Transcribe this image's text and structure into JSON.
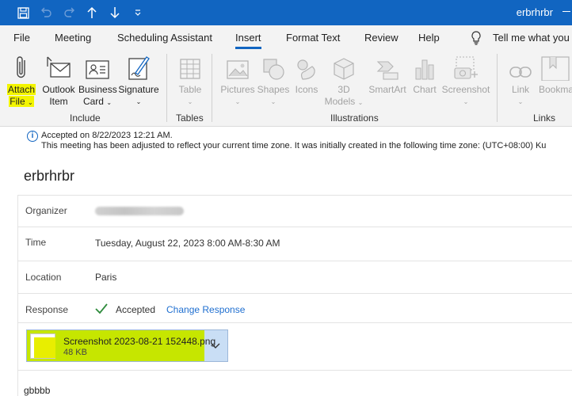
{
  "window": {
    "title": "erbrhrbr"
  },
  "quick_access": {
    "icons": [
      "save-icon",
      "undo-icon",
      "redo-icon",
      "arrow-up-icon",
      "arrow-down-icon",
      "customize-icon"
    ]
  },
  "tabs": [
    {
      "label": "File"
    },
    {
      "label": "Meeting"
    },
    {
      "label": "Scheduling Assistant"
    },
    {
      "label": "Insert",
      "active": true
    },
    {
      "label": "Format Text"
    },
    {
      "label": "Review"
    },
    {
      "label": "Help"
    },
    {
      "label": "Tell me what you"
    }
  ],
  "ribbon": {
    "include": {
      "label": "Include",
      "attach_file": {
        "line1": "Attach",
        "line2": "File"
      },
      "outlook_item": {
        "line1": "Outlook",
        "line2": "Item"
      },
      "business_card": {
        "line1": "Business",
        "line2": "Card"
      },
      "signature": {
        "line1": "Signature",
        "line2": ""
      }
    },
    "tables": {
      "label": "Tables",
      "table": "Table"
    },
    "illustrations": {
      "label": "Illustrations",
      "pictures": "Pictures",
      "shapes": "Shapes",
      "icons": "Icons",
      "models_line1": "3D",
      "models_line2": "Models",
      "smartart": "SmartArt",
      "chart": "Chart",
      "screenshot": "Screenshot"
    },
    "links": {
      "label": "Links",
      "link": "Link",
      "bookmark": "Bookma"
    }
  },
  "info": {
    "line1": "Accepted on 8/22/2023 12:21 AM.",
    "line2": "This meeting has been adjusted to reflect your current time zone. It was initially created in the following time zone: (UTC+08:00) Ku"
  },
  "meeting": {
    "subject": "erbrhrbr",
    "organizer_label": "Organizer",
    "time_label": "Time",
    "time_value": "Tuesday, August 22, 2023 8:00 AM-8:30 AM",
    "location_label": "Location",
    "location_value": "Paris",
    "response_label": "Response",
    "response_status": "Accepted",
    "change_response": "Change Response"
  },
  "attachment": {
    "name": "Screenshot 2023-08-21 152448.png",
    "size": "48 KB"
  },
  "body": {
    "text": "gbbbb"
  },
  "colors": {
    "accent": "#1165c1",
    "highlight": "#f3f500",
    "attachment_highlight": "#c6e600",
    "link": "#1f6fd0"
  }
}
